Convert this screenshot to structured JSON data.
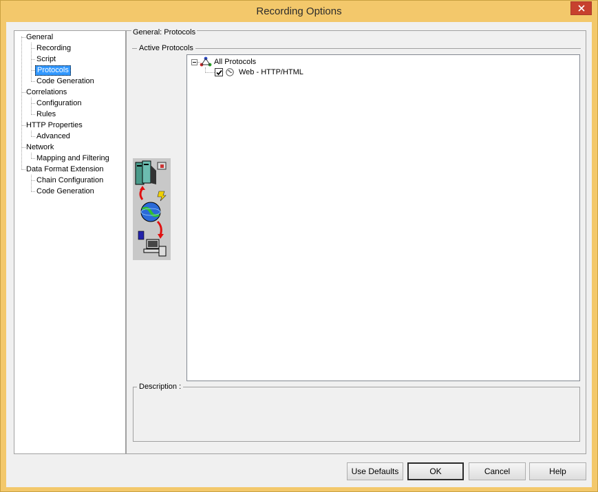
{
  "window": {
    "title": "Recording Options"
  },
  "tree": {
    "items": [
      {
        "label": "General",
        "level": 0
      },
      {
        "label": "Recording",
        "level": 1
      },
      {
        "label": "Script",
        "level": 1
      },
      {
        "label": "Protocols",
        "level": 1,
        "selected": true
      },
      {
        "label": "Code Generation",
        "level": 1
      },
      {
        "label": "Correlations",
        "level": 0
      },
      {
        "label": "Configuration",
        "level": 1
      },
      {
        "label": "Rules",
        "level": 1
      },
      {
        "label": "HTTP Properties",
        "level": 0
      },
      {
        "label": "Advanced",
        "level": 1
      },
      {
        "label": "Network",
        "level": 0
      },
      {
        "label": "Mapping and Filtering",
        "level": 1
      },
      {
        "label": "Data Format Extension",
        "level": 0
      },
      {
        "label": "Chain Configuration",
        "level": 1
      },
      {
        "label": "Code Generation",
        "level": 1
      }
    ]
  },
  "panel": {
    "section_title": "General: Protocols",
    "group_title": "Active Protocols",
    "protocols": {
      "root_label": "All Protocols",
      "items": [
        {
          "label": "Web - HTTP/HTML",
          "checked": true
        }
      ]
    },
    "description_label": "Description :"
  },
  "buttons": {
    "use_defaults": "Use Defaults",
    "ok": "OK",
    "cancel": "Cancel",
    "help": "Help"
  },
  "colors": {
    "titlebar": "#f3c86b",
    "close_button": "#c7412e",
    "selection": "#3399ff"
  }
}
